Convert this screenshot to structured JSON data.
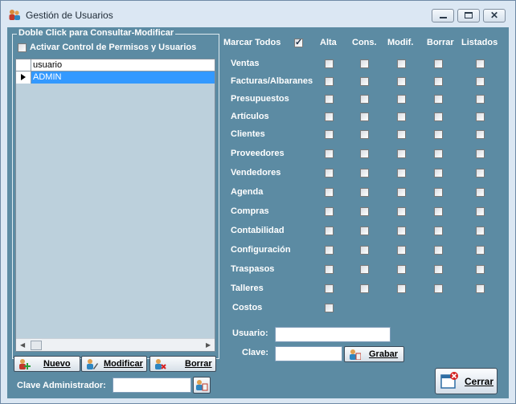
{
  "window": {
    "title": "Gestión de Usuarios"
  },
  "left": {
    "group_title": "Doble Click para Consultar-Modificar",
    "activate_label": "Activar Control de Permisos y Usuarios",
    "activate_checked": false,
    "grid": {
      "column": "usuario",
      "rows": [
        "ADMIN"
      ]
    },
    "buttons": {
      "nuevo": "Nuevo",
      "modificar": "Modificar",
      "borrar": "Borrar"
    },
    "admin_key_label": "Clave Administrador:",
    "admin_key_value": ""
  },
  "right": {
    "mark_all_label": "Marcar Todos",
    "mark_all_checked": true,
    "columns": [
      "Alta",
      "Cons.",
      "Modif.",
      "Borrar",
      "Listados"
    ],
    "modules": [
      "Ventas",
      "Facturas/Albaranes",
      "Presupuestos",
      "Artículos",
      "Clientes",
      "Proveedores",
      "Vendedores",
      "Agenda",
      "Compras",
      "Contabilidad",
      "Configuración",
      "Traspasos",
      "Talleres"
    ],
    "costos_label": "Costos",
    "usuario_label": "Usuario:",
    "usuario_value": "",
    "clave_label": "Clave:",
    "clave_value": "",
    "grabar_label": "Grabar",
    "cerrar_label": "Cerrar"
  },
  "colors": {
    "panel": "#5c8ba3",
    "selection": "#3399ff",
    "titlebar": "#dbe7f3"
  }
}
